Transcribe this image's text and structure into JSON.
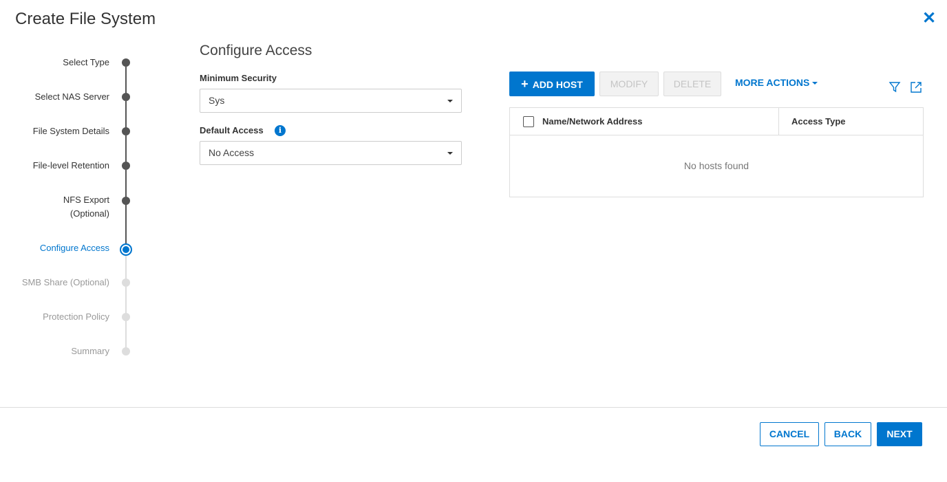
{
  "dialog": {
    "title": "Create File System",
    "close_icon": "close-icon"
  },
  "steps": [
    {
      "label": "Select Type",
      "state": "done"
    },
    {
      "label": "Select NAS Server",
      "state": "done"
    },
    {
      "label": "File System Details",
      "state": "done"
    },
    {
      "label": "File-level Retention",
      "state": "done"
    },
    {
      "label": "NFS Export",
      "label2": "(Optional)",
      "state": "done"
    },
    {
      "label": "Configure Access",
      "state": "current"
    },
    {
      "label": "SMB Share (Optional)",
      "state": "future"
    },
    {
      "label": "Protection Policy",
      "state": "future"
    },
    {
      "label": "Summary",
      "state": "future"
    }
  ],
  "main": {
    "title": "Configure Access",
    "minimum_security": {
      "label": "Minimum Security",
      "value": "Sys"
    },
    "default_access": {
      "label": "Default Access",
      "value": "No Access",
      "info": "i"
    }
  },
  "toolbar": {
    "add_host": "ADD HOST",
    "add_icon": "+",
    "modify": "MODIFY",
    "delete": "DELETE",
    "more_actions": "MORE ACTIONS"
  },
  "table": {
    "columns": [
      "Name/Network Address",
      "Access Type"
    ],
    "empty": "No hosts found"
  },
  "footer": {
    "cancel": "CANCEL",
    "back": "BACK",
    "next": "NEXT"
  },
  "colors": {
    "accent": "#0076ce"
  }
}
